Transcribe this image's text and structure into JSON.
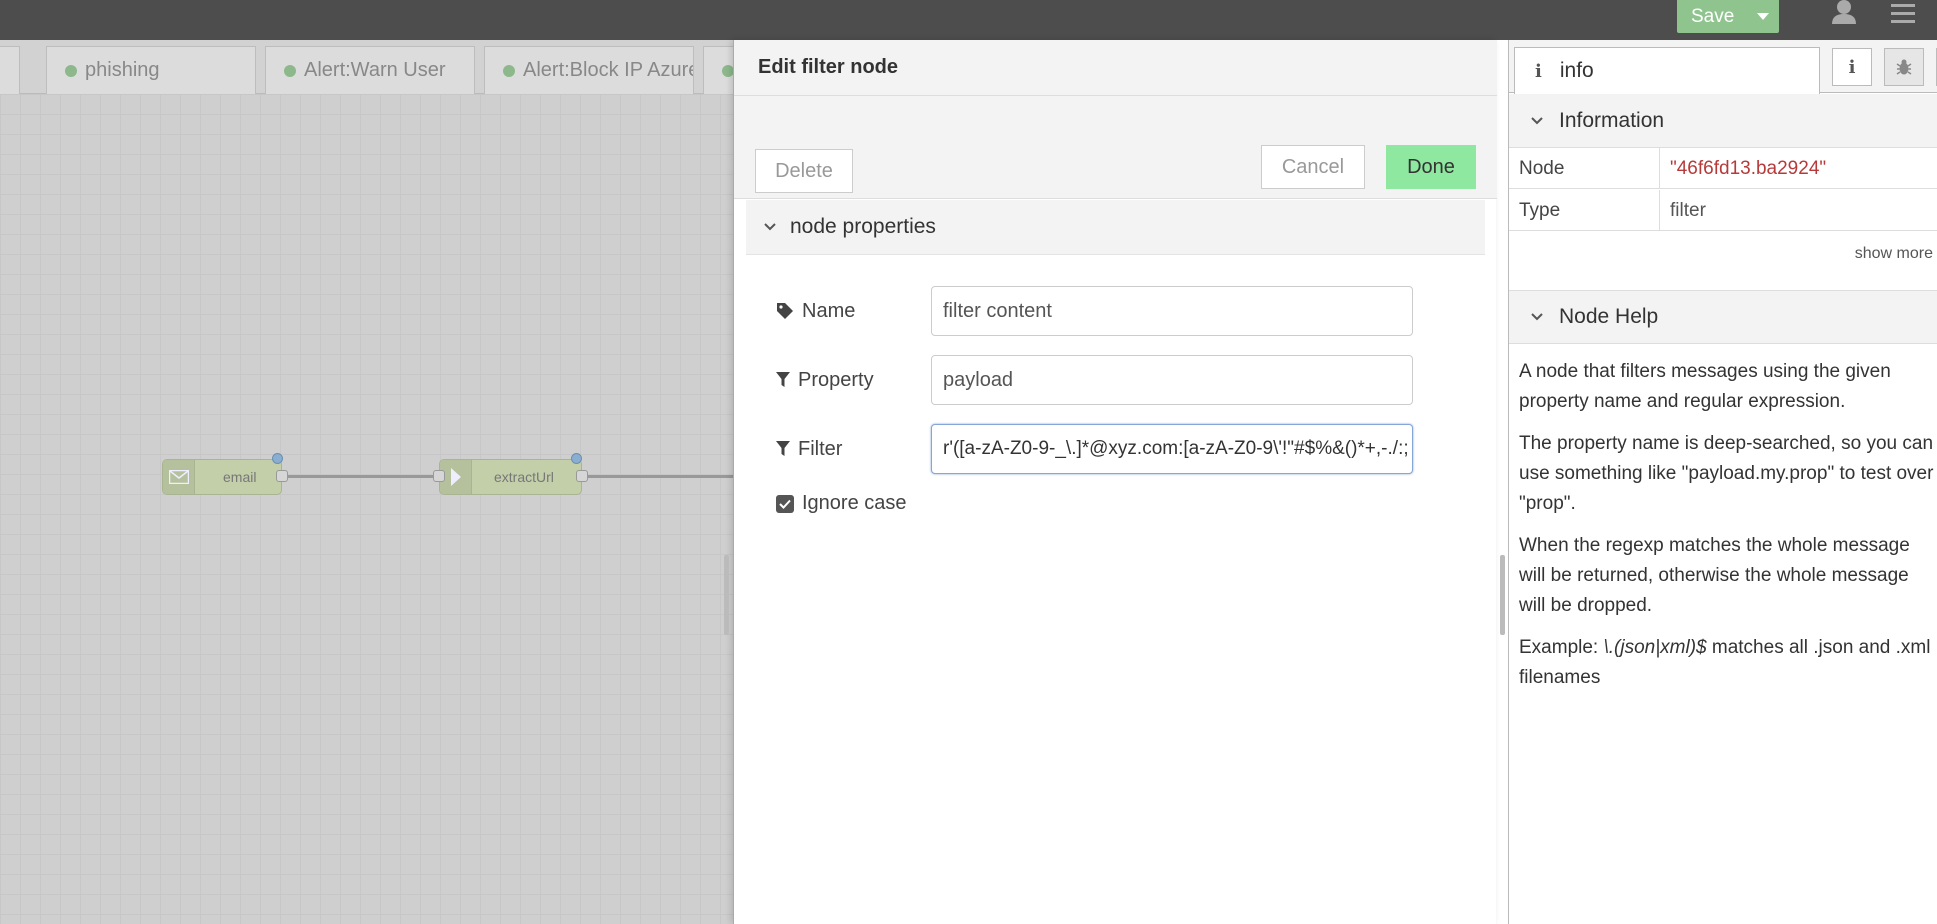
{
  "header": {
    "save_label": "Save"
  },
  "workspace": {
    "tabs": [
      {
        "label": "phishing"
      },
      {
        "label": "Alert:Warn User"
      },
      {
        "label": "Alert:Block IP Azure"
      }
    ],
    "nodes": [
      {
        "label": "email",
        "icon": "envelope-icon"
      },
      {
        "label": "extractUrl",
        "icon": "function-icon"
      }
    ]
  },
  "editor": {
    "title": "Edit filter node",
    "delete_label": "Delete",
    "cancel_label": "Cancel",
    "done_label": "Done",
    "section_label": "node properties",
    "fields": {
      "name": {
        "label": "Name",
        "value": "filter content"
      },
      "property": {
        "label": "Property",
        "value": "payload"
      },
      "filter": {
        "label": "Filter",
        "value": "r'([a-zA-Z0-9-_\\.]*@xyz.com:[a-zA-Z0-9\\'!\"#$%&()*+,-./:;"
      }
    },
    "ignore_case": {
      "label": "Ignore case",
      "checked": true
    }
  },
  "sidebar": {
    "tab_label": "info",
    "information_title": "Information",
    "rows": [
      {
        "key": "Node",
        "value": "\"46f6fd13.ba2924\""
      },
      {
        "key": "Type",
        "value": "filter"
      }
    ],
    "show_more": "show more",
    "help_title": "Node Help",
    "help": {
      "p1a": "A node that filters messages using the given",
      "p1b": "property name and regular expression.",
      "p2a": "The property name is deep-searched, so you can",
      "p2b": "use something like \"payload.my.prop\" to test over",
      "p2c": "\"prop\".",
      "p3a": "When the regexp matches the whole message",
      "p3b": "will be returned, otherwise the whole message",
      "p3c": "will be dropped.",
      "p4_prefix": "Example: ",
      "p4_code": "\\.(json|xml)$",
      "p4_suffix": " matches all .json and .xml",
      "p4b": "filenames"
    }
  },
  "colors": {
    "header": "#4d4d4d",
    "save": "#8fc48f",
    "done": "#8fe8a0",
    "string_value": "#b73a3a"
  }
}
